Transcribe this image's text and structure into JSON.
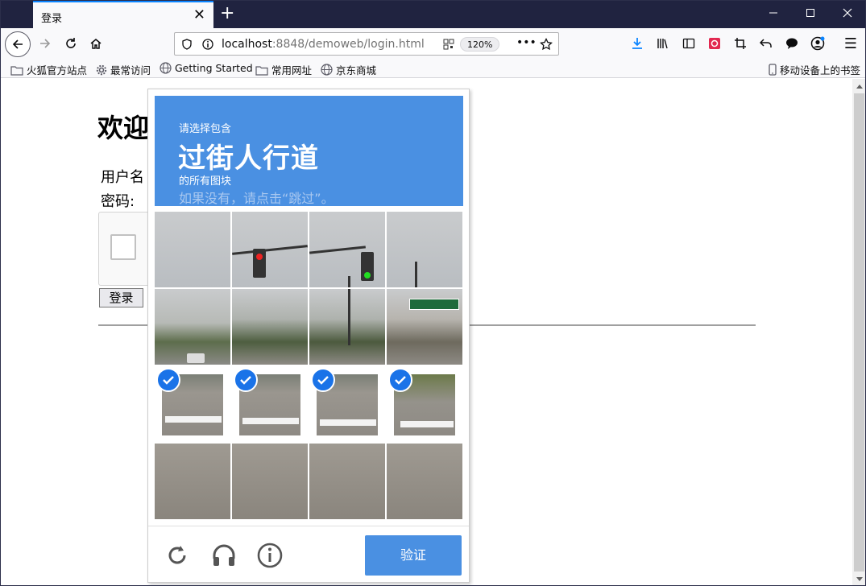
{
  "browser": {
    "tab_title": "登录",
    "tab_close": "✕",
    "new_tab": "+",
    "url_host": "localhost",
    "url_rest": ":8848/demoweb/login.html",
    "zoom": "120%",
    "more": "•••",
    "menu": "☰"
  },
  "bookmarks": [
    {
      "label": "火狐官方站点",
      "icon": "folder-icon"
    },
    {
      "label": "最常访问",
      "icon": "gear-icon"
    },
    {
      "label": "Getting Started",
      "icon": "globe-icon"
    },
    {
      "label": "常用网址",
      "icon": "folder-icon"
    },
    {
      "label": "京东商城",
      "icon": "globe-icon"
    },
    {
      "label": "移动设备上的书签",
      "icon": "mobile-icon"
    }
  ],
  "page": {
    "heading": "欢迎",
    "username_label": "用户名",
    "password_label": "密码:",
    "login_button": "登录"
  },
  "captcha": {
    "instruction_top": "请选择包含",
    "target": "过街人行道",
    "instruction_bottom": "的所有图块",
    "skip_hint": "如果没有，请点击“跳过”。",
    "verify_button": "验证",
    "selected_tiles": [
      8,
      9,
      10,
      11
    ],
    "accent_color": "#4a90e2"
  }
}
